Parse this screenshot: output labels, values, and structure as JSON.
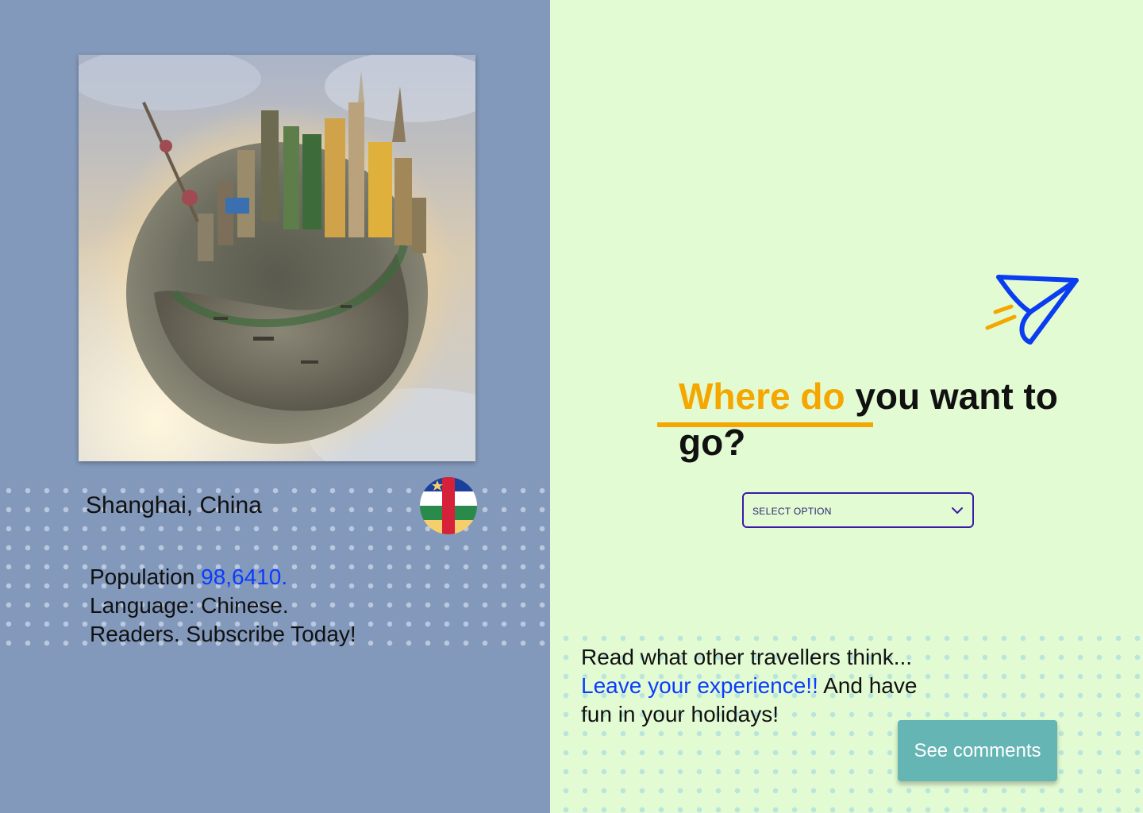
{
  "destination": {
    "city": "Shanghai, China",
    "population_label": "Population",
    "population_value": "98,6410.",
    "language_line": "Language: Chinese.",
    "subscribe_line": "Readers. Subscribe Today!",
    "photo_icon": "tiny-planet-city-photo",
    "flag_icon": "central-african-republic-flag"
  },
  "hero": {
    "headline_accent": "Where do",
    "headline_rest": " you want to go?",
    "icon": "paper-plane-icon"
  },
  "select": {
    "value": "SELECT OPTION"
  },
  "community": {
    "line1": "Read what other travellers think...",
    "link_text": "Leave your experience!!",
    "rest": " And have fun in your holidays!",
    "button_label": "See comments"
  },
  "colors": {
    "left_bg": "#8399bb",
    "right_bg": "#e2fbd2",
    "accent_orange": "#f5a700",
    "link_blue": "#0a3cff",
    "button_teal": "#66b5b5",
    "select_border": "#3a1aa6"
  }
}
